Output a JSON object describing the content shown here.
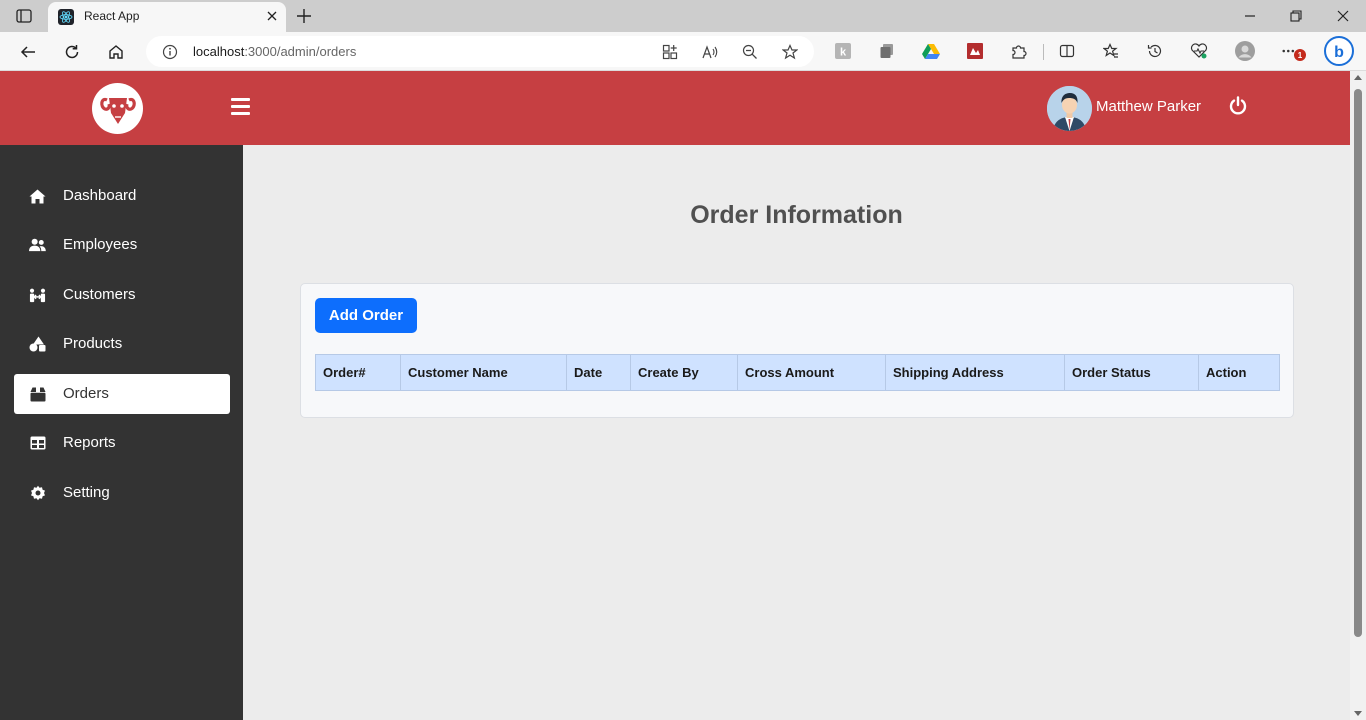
{
  "browser": {
    "tab_title": "React App",
    "url_host": "localhost",
    "url_path": ":3000/admin/orders",
    "notification_count": "1",
    "colors": {
      "tabbar": "#cdcdcd",
      "toolbar": "#f7f7f7"
    }
  },
  "header": {
    "user_name": "Matthew Parker",
    "colors": {
      "background": "#c63f42"
    },
    "icons": {
      "logo": "ram-logo-icon",
      "menu": "hamburger-icon",
      "power": "power-icon"
    }
  },
  "sidebar": {
    "items": [
      {
        "label": "Dashboard",
        "icon": "home-icon",
        "active": false
      },
      {
        "label": "Employees",
        "icon": "users-icon",
        "active": false
      },
      {
        "label": "Customers",
        "icon": "people-arrows-icon",
        "active": false
      },
      {
        "label": "Products",
        "icon": "shapes-icon",
        "active": false
      },
      {
        "label": "Orders",
        "icon": "box-icon",
        "active": true
      },
      {
        "label": "Reports",
        "icon": "table-icon",
        "active": false
      },
      {
        "label": "Setting",
        "icon": "gear-icon",
        "active": false
      }
    ],
    "colors": {
      "background": "#333333",
      "active_bg": "#ffffff"
    }
  },
  "main": {
    "title": "Order Information",
    "add_button_label": "Add Order",
    "table": {
      "columns": [
        "Order#",
        "Customer Name",
        "Date",
        "Create By",
        "Cross Amount",
        "Shipping Address",
        "Order Status",
        "Action"
      ],
      "rows": []
    },
    "colors": {
      "button": "#0d6efd",
      "table_header": "#cfe2ff"
    }
  }
}
